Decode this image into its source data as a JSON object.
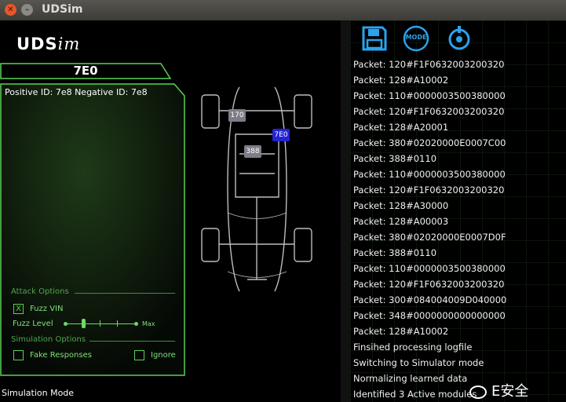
{
  "window": {
    "title": "UDSim"
  },
  "logo": {
    "main": "UDS",
    "italic": "im"
  },
  "selected_module": "7E0",
  "ids_line": "Positive ID: 7e8 Negative ID: 7e8",
  "attack": {
    "section": "Attack Options",
    "fuzz_vin_label": "Fuzz VIN",
    "fuzz_vin_checked": true,
    "fuzz_level_label": "Fuzz Level",
    "fuzz_level_max": "Max",
    "fuzz_level_value": 0.25
  },
  "simulation": {
    "section": "Simulation Options",
    "fake_responses_label": "Fake Responses",
    "ignore_label": "Ignore"
  },
  "car_tags": [
    {
      "label": "170",
      "color": "grey"
    },
    {
      "label": "388",
      "color": "grey"
    },
    {
      "label": "7E0",
      "color": "blue"
    }
  ],
  "status_text": "Simulation Mode",
  "toolbar": {
    "save_icon": "floppy-disk-icon",
    "mode_label": "MODE",
    "target_icon": "target-icon"
  },
  "log": [
    "Packet: 120#F1F0632003200320",
    "Packet: 128#A10002",
    "Packet: 110#0000003500380000",
    "Packet: 120#F1F0632003200320",
    "Packet: 128#A20001",
    "Packet: 380#02020000E0007C00",
    "Packet: 388#0110",
    "Packet: 110#0000003500380000",
    "Packet: 120#F1F0632003200320",
    "Packet: 128#A30000",
    "Packet: 128#A00003",
    "Packet: 380#02020000E0007D0F",
    "Packet: 388#0110",
    "Packet: 110#0000003500380000",
    "Packet: 120#F1F0632003200320",
    "Packet: 300#084004009D040000",
    "Packet: 348#0000000000000000",
    "Packet: 128#A10002",
    "Finsihed processing logfile",
    "Switching to Simulator mode",
    "Normalizing learned data",
    "Identified 3 Active modules"
  ],
  "watermark": "E安全",
  "colors": {
    "accent_green": "#5ad153",
    "tag_blue": "#2323d6",
    "tag_grey": "#7c7d88"
  }
}
